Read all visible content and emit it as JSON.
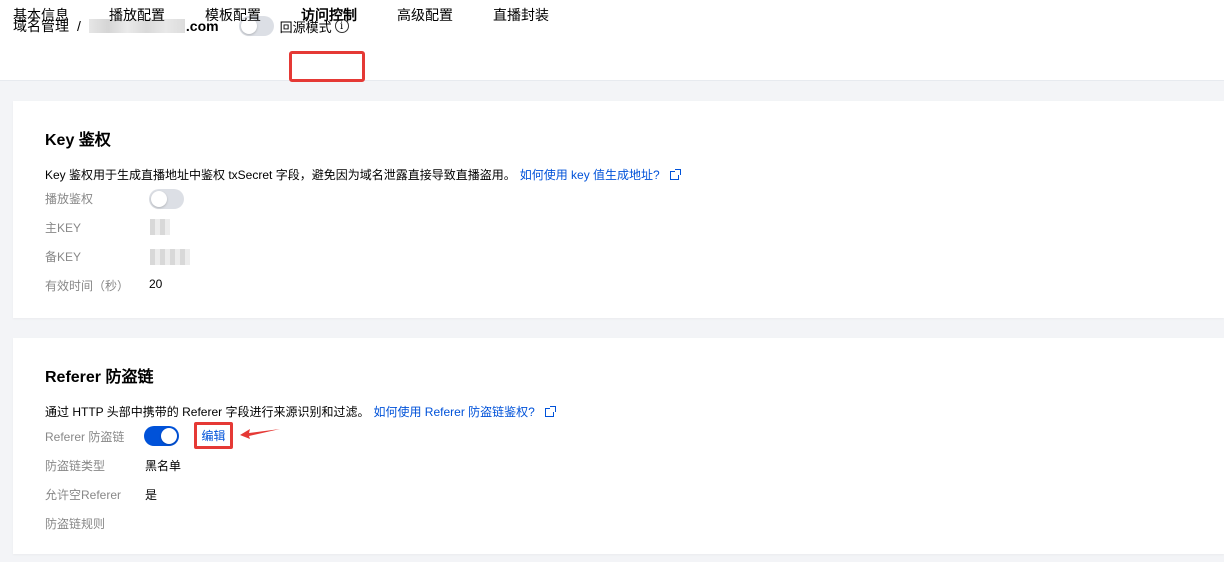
{
  "breadcrumb": {
    "root": "域名管理",
    "separator": "/",
    "domain_suffix": ".com"
  },
  "origin_mode": {
    "label": "回源模式",
    "enabled": false,
    "info_icon": "info-circle-icon"
  },
  "tabs": [
    {
      "label": "基本信息",
      "active": false
    },
    {
      "label": "播放配置",
      "active": false
    },
    {
      "label": "模板配置",
      "active": false
    },
    {
      "label": "访问控制",
      "active": true
    },
    {
      "label": "高级配置",
      "active": false
    },
    {
      "label": "直播封装",
      "active": false
    }
  ],
  "key_auth": {
    "title": "Key 鉴权",
    "description": "Key 鉴权用于生成直播地址中鉴权 txSecret 字段，避免因为域名泄露直接导致直播盗用。",
    "help_link": "如何使用 key 值生成地址?",
    "rows": {
      "play_auth": {
        "label": "播放鉴权",
        "enabled": false
      },
      "main_key": {
        "label": "主KEY"
      },
      "backup_key": {
        "label": "备KEY"
      },
      "valid_time": {
        "label": "有效时间（秒）",
        "value": "20"
      }
    }
  },
  "referer": {
    "title": "Referer 防盗链",
    "description": "通过 HTTP 头部中携带的 Referer 字段进行来源识别和过滤。",
    "help_link": "如何使用 Referer 防盗链鉴权?",
    "rows": {
      "switch": {
        "label": "Referer 防盗链",
        "enabled": true,
        "edit_label": "编辑"
      },
      "type": {
        "label": "防盗链类型",
        "value": "黑名单"
      },
      "allow_empty": {
        "label": "允许空Referer",
        "value": "是"
      },
      "rules": {
        "label": "防盗链规则"
      }
    }
  },
  "colors": {
    "accent": "#0052d9",
    "highlight": "#e53935",
    "page_bg": "#f3f4f7"
  }
}
